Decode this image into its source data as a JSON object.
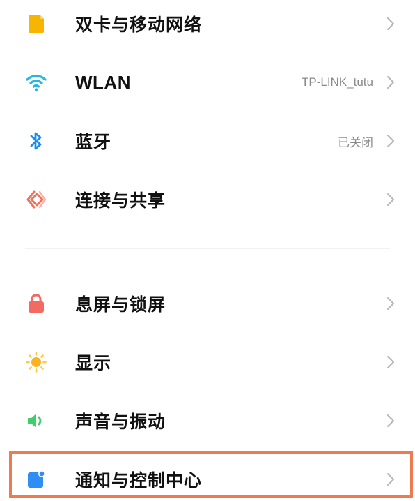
{
  "settings": {
    "group1": [
      {
        "key": "sim",
        "label": "双卡与移动网络",
        "value": "",
        "icon": "sim-card-icon"
      },
      {
        "key": "wlan",
        "label": "WLAN",
        "value": "TP-LINK_tutu",
        "icon": "wifi-icon"
      },
      {
        "key": "bluetooth",
        "label": "蓝牙",
        "value": "已关闭",
        "icon": "bluetooth-icon"
      },
      {
        "key": "share",
        "label": "连接与共享",
        "value": "",
        "icon": "connection-share-icon"
      }
    ],
    "group2": [
      {
        "key": "lock",
        "label": "息屏与锁屏",
        "value": "",
        "icon": "lock-icon"
      },
      {
        "key": "display",
        "label": "显示",
        "value": "",
        "icon": "sun-icon"
      },
      {
        "key": "sound",
        "label": "声音与振动",
        "value": "",
        "icon": "speaker-icon"
      },
      {
        "key": "notify",
        "label": "通知与控制中心",
        "value": "",
        "icon": "notification-icon"
      }
    ]
  },
  "colors": {
    "sim": "#f7b500",
    "wifi": "#22b7e6",
    "bluetooth": "#1a8cf0",
    "share": "#f0705a",
    "lock": "#f26b63",
    "sun": "#ffb21f",
    "speaker": "#3ccf6a",
    "notify": "#2e8ef5",
    "highlight": "#ee7a52"
  }
}
